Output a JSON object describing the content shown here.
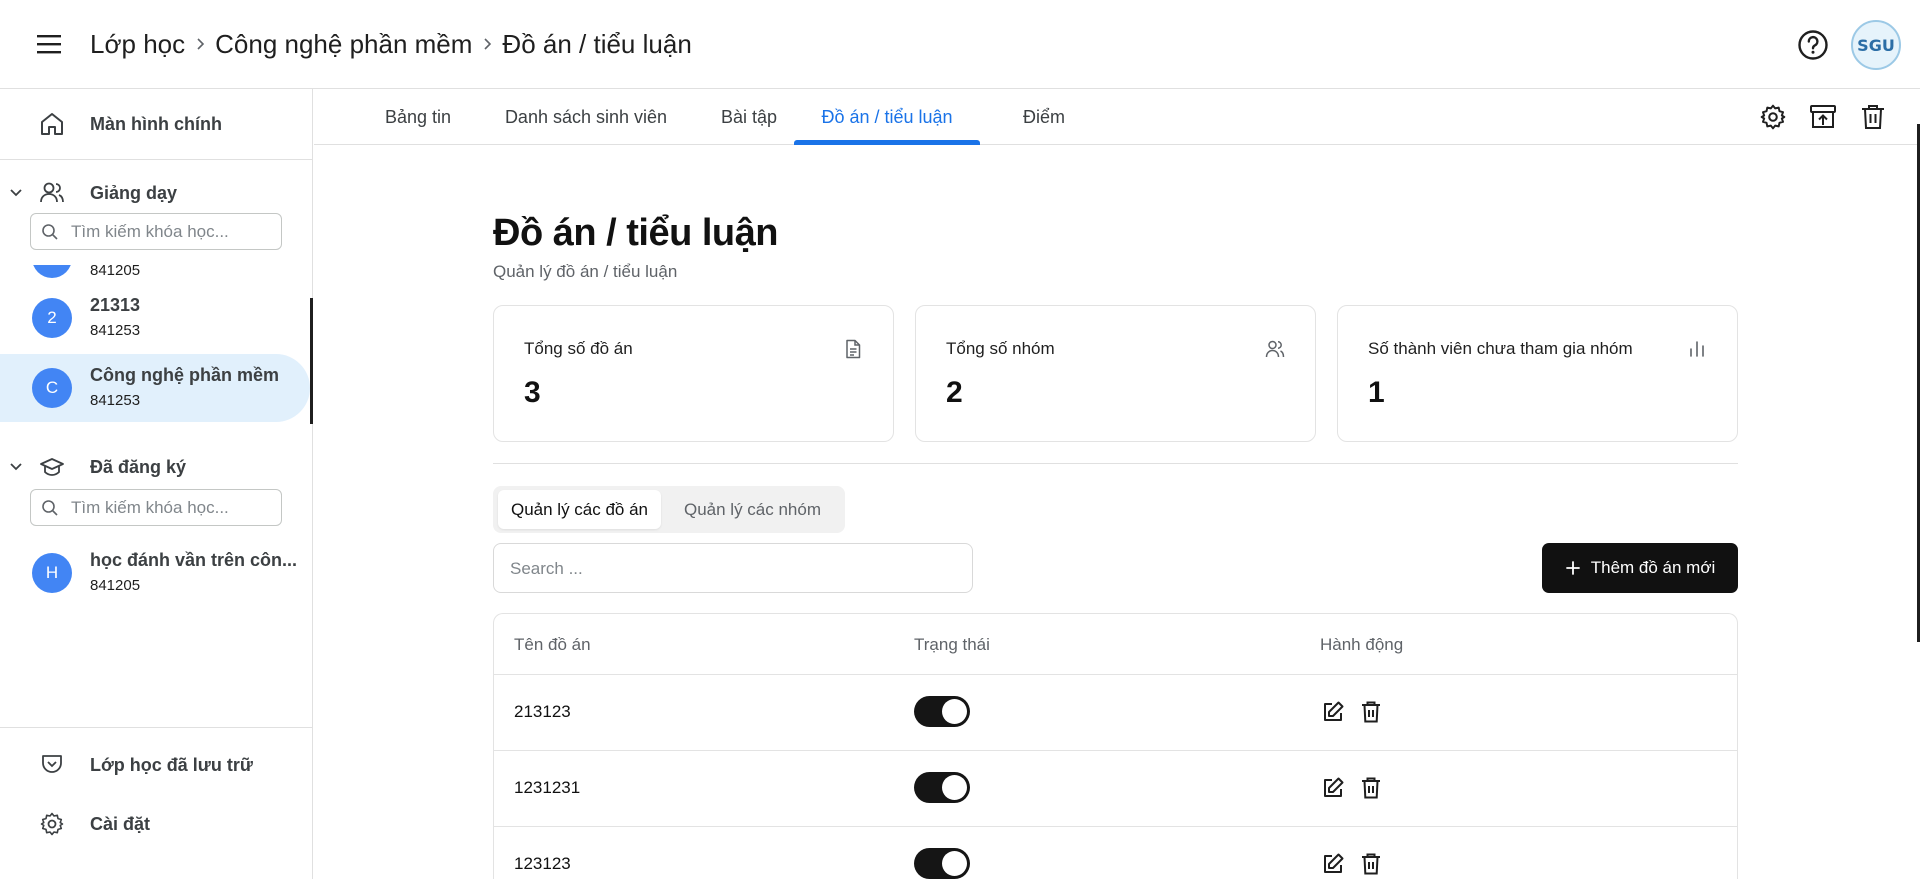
{
  "header": {
    "breadcrumbs": [
      "Lớp học",
      "Công nghệ phần mềm",
      "Đồ án / tiểu luận"
    ],
    "avatar_text": "SGU"
  },
  "sidebar": {
    "home_label": "Màn hình chính",
    "teaching": {
      "label": "Giảng dạy",
      "search_placeholder": "Tìm kiếm khóa học...",
      "partial_code": "841205",
      "courses": [
        {
          "badge": "2",
          "title": "21313",
          "code": "841253"
        },
        {
          "badge": "C",
          "title": "Công nghệ phần mềm",
          "code": "841253"
        }
      ]
    },
    "enrolled": {
      "label": "Đã đăng ký",
      "search_placeholder": "Tìm kiếm khóa học...",
      "courses": [
        {
          "badge": "H",
          "title": "học đánh vần trên côn...",
          "code": "841205"
        }
      ]
    },
    "archived_label": "Lớp học đã lưu trữ",
    "settings_label": "Cài đặt"
  },
  "tabs": [
    "Bảng tin",
    "Danh sách sinh viên",
    "Bài tập",
    "Đồ án / tiểu luận",
    "Điểm"
  ],
  "main": {
    "title": "Đồ án / tiểu luận",
    "subtitle": "Quản lý đồ án / tiểu luận",
    "stats": [
      {
        "label": "Tổng số đồ án",
        "value": "3",
        "icon": "document-icon"
      },
      {
        "label": "Tổng số nhóm",
        "value": "2",
        "icon": "users-icon"
      },
      {
        "label": "Số thành viên chưa tham gia nhóm",
        "value": "1",
        "icon": "bar-chart-icon"
      }
    ],
    "segments": [
      "Quản lý các đồ án",
      "Quản lý các nhóm"
    ],
    "search_placeholder": "Search ...",
    "add_button": "Thêm đồ án mới",
    "table": {
      "headers": [
        "Tên đồ án",
        "Trạng thái",
        "Hành động"
      ],
      "rows": [
        {
          "name": "213123",
          "status_on": true
        },
        {
          "name": "1231231",
          "status_on": true
        },
        {
          "name": "123123",
          "status_on": true
        }
      ]
    }
  },
  "colors": {
    "accent": "#1a73e8",
    "active_item_bg": "#e1f0fc",
    "course_badge": "#4285f4",
    "primary_button": "#111111"
  }
}
